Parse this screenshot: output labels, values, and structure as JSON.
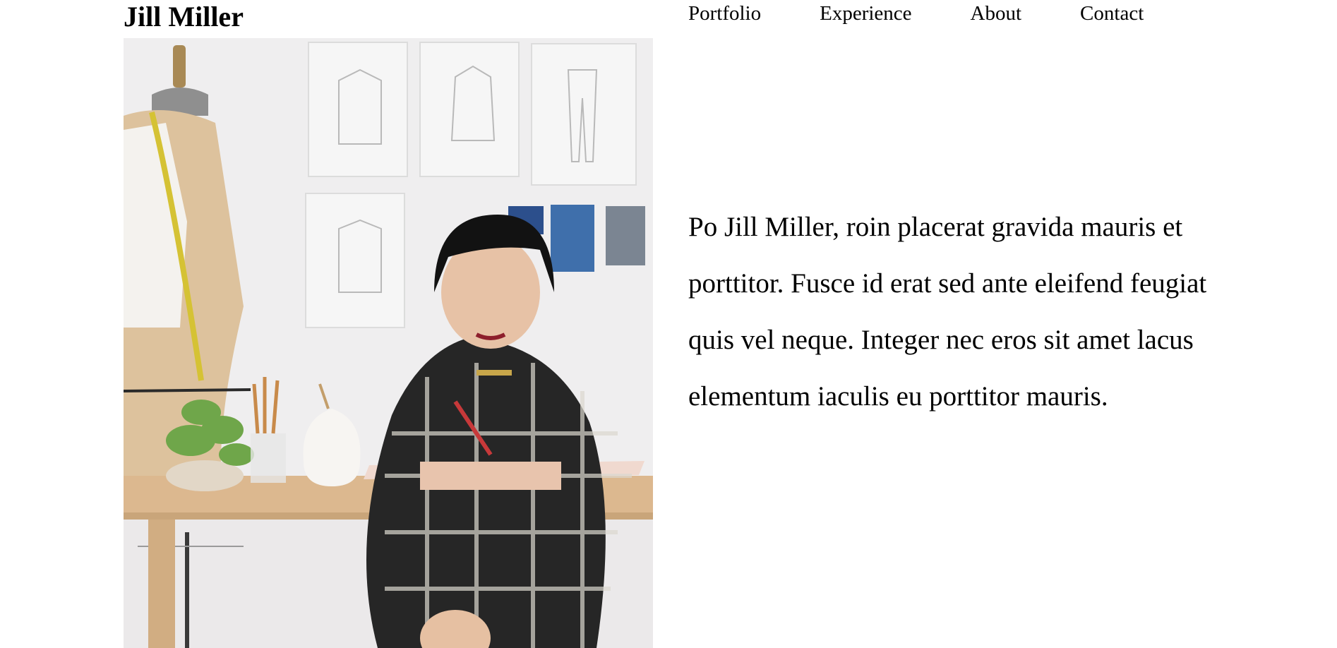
{
  "header": {
    "site_title": "Jill Miller",
    "nav": [
      {
        "label": "Portfolio"
      },
      {
        "label": "Experience"
      },
      {
        "label": "About"
      },
      {
        "label": "Contact"
      }
    ]
  },
  "hero": {
    "icon": "designer-photo"
  },
  "main": {
    "intro_text": "Po Jill Miller, roin placerat gravida mauris et porttitor. Fusce id erat sed ante eleifend feugiat quis vel neque. Integer nec eros sit amet lacus elementum iaculis eu porttitor mauris."
  },
  "colors": {
    "background": "#ffffff",
    "text": "#000000"
  }
}
